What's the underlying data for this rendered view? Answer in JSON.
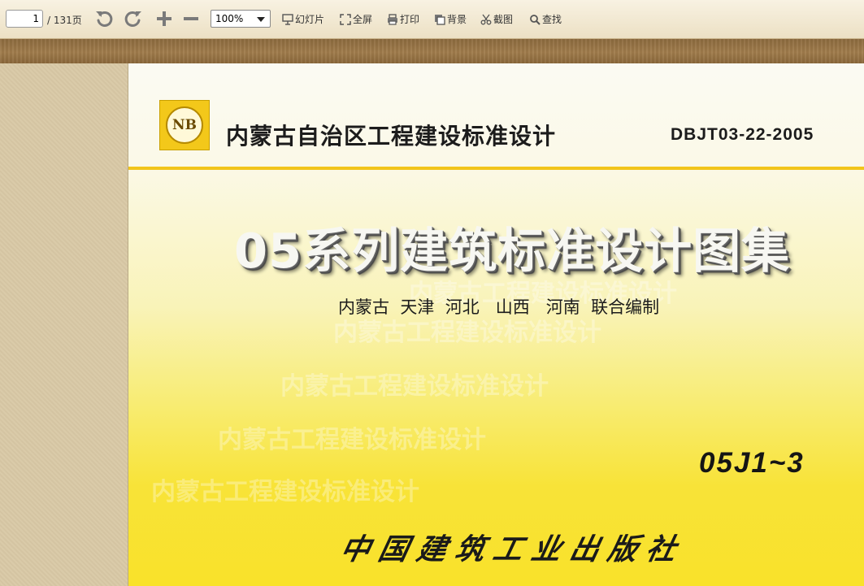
{
  "toolbar": {
    "page_current": "1",
    "page_total": "/ 131页",
    "zoom": "100%",
    "buttons": [
      {
        "label": "幻灯片",
        "icon": "slideshow-icon"
      },
      {
        "label": "全屏",
        "icon": "fullscreen-icon"
      },
      {
        "label": "打印",
        "icon": "print-icon"
      },
      {
        "label": "背景",
        "icon": "background-icon"
      },
      {
        "label": "截图",
        "icon": "scissors-icon"
      },
      {
        "label": "查找",
        "icon": "search-icon"
      }
    ]
  },
  "document": {
    "logo_text": "NB",
    "org_name": "内蒙古自治区工程建设标准设计",
    "std_code": "DBJT03-22-2005",
    "main_title": "05系列建筑标准设计图集",
    "subtitle": "内蒙古  天津  河北   山西   河南  联合编制",
    "watermark_text": "内蒙古工程建设标准设计",
    "atlas_code": "05J1~3",
    "publisher": "中国建筑工业出版社"
  },
  "colors": {
    "toolbar_bg": "#f3ead4",
    "wood": "#987444",
    "panel": "#d9c9a6",
    "cover_yellow": "#f9e22a",
    "rule": "#f2c51a"
  }
}
